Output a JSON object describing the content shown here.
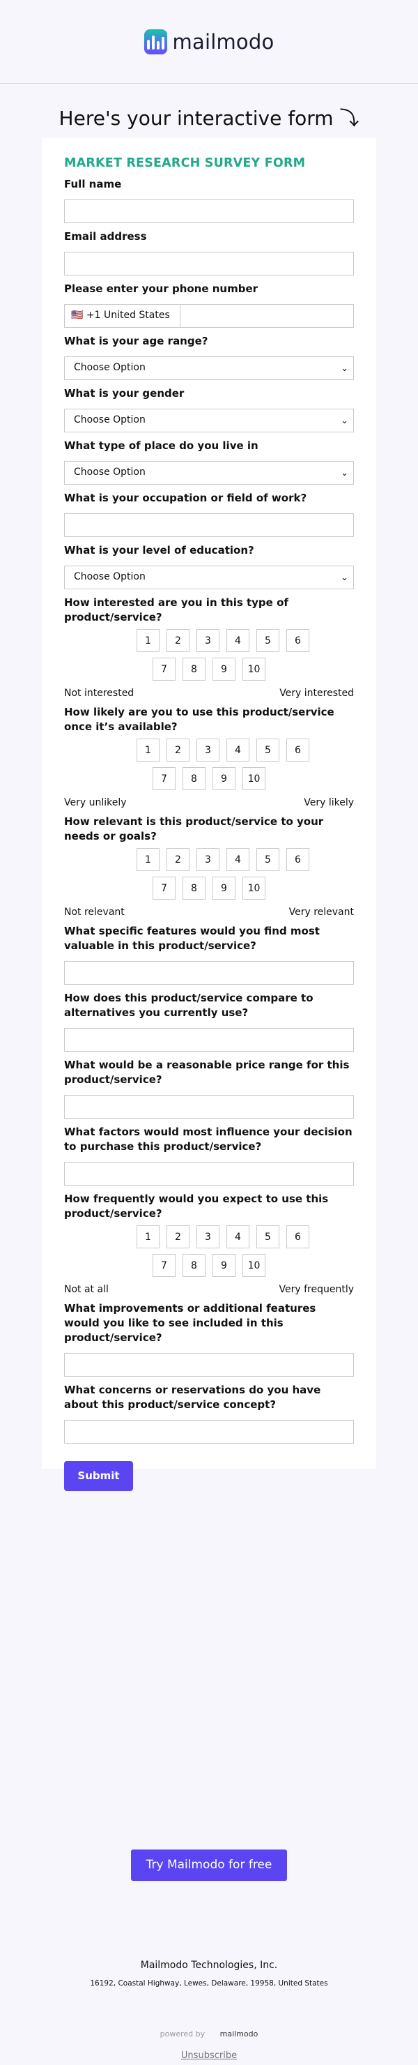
{
  "header": {
    "brand": "mailmodo"
  },
  "headline": "Here's your interactive form ⤵",
  "form": {
    "title": "MARKET RESEARCH SURVEY FORM",
    "full_name_label": "Full name",
    "email_label": "Email address",
    "phone_label": "Please enter your phone number",
    "phone_country": "🇺🇸 +1 United States",
    "age_label": "What is your age range?",
    "age_value": "Choose Option",
    "gender_label": "What is your gender",
    "gender_value": "Choose Option",
    "place_label": "What type of place do you live in",
    "place_value": "Choose Option",
    "occupation_label": "What is your occupation or field of work?",
    "education_label": "What is your level of education?",
    "education_value": "Choose Option",
    "q_interest": {
      "label": "How interested are you in this type of product/service?",
      "low": "Not interested",
      "high": "Very interested"
    },
    "q_likely": {
      "label": "How likely are you to use this product/service once it’s available?",
      "low": "Very unlikely",
      "high": "Very likely"
    },
    "q_relevant": {
      "label": "How relevant is this product/service to your needs or goals?",
      "low": "Not relevant",
      "high": "Very relevant"
    },
    "q_features_label": "What specific features would you find most valuable in this product/service?",
    "q_compare_label": "How does this product/service compare to alternatives you currently use?",
    "q_price_label": "What would be a reasonable price range for this product/service?",
    "q_factors_label": "What factors would most influence your decision to purchase this product/service?",
    "q_frequency": {
      "label": "How frequently would you expect to use this product/service?",
      "low": "Not at all",
      "high": "Very frequently"
    },
    "q_improve_label": "What improvements or additional features would you like to see included in this product/service?",
    "q_concerns_label": "What concerns or reservations do you have about this product/service concept?",
    "scale_options": [
      "1",
      "2",
      "3",
      "4",
      "5",
      "6",
      "7",
      "8",
      "9",
      "10"
    ],
    "submit": "Submit"
  },
  "footer": {
    "cta": "Try Mailmodo for free",
    "company": "Mailmodo Technologies, Inc.",
    "address": "16192, Coastal Highway, Lewes, Delaware, 19958, United States",
    "powered_by": "powered by",
    "powered_brand": "mailmodo",
    "unsubscribe": "Unsubscribe"
  },
  "colors": {
    "accent": "#5b45f2",
    "title_green": "#22a98a",
    "background": "#f6f6fc"
  }
}
